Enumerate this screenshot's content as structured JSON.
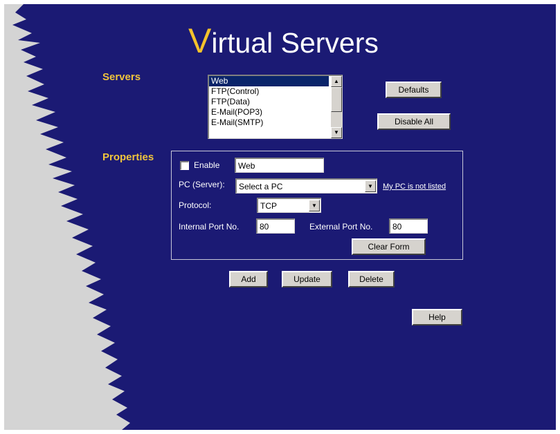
{
  "page": {
    "title_initial": "V",
    "title_rest": "irtual Servers",
    "colors": {
      "background": "#1b1a74",
      "side_panel": "#d4d4d4",
      "heading": "#f0c43c",
      "title_accent": "#f3c22c"
    }
  },
  "servers": {
    "heading": "Servers",
    "list_items": [
      "Web",
      "FTP(Control)",
      "FTP(Data)",
      "E-Mail(POP3)",
      "E-Mail(SMTP)"
    ],
    "selected": "Web",
    "defaults_label": "Defaults",
    "disable_all_label": "Disable All"
  },
  "properties": {
    "heading": "Properties",
    "enable_label": "Enable",
    "enable_checked": false,
    "name_value": "Web",
    "pc_label": "PC (Server):",
    "pc_value": "Select a PC",
    "pc_link": "My PC is not listed",
    "protocol_label": "Protocol:",
    "protocol_value": "TCP",
    "internal_port_label": "Internal Port No.",
    "internal_port_value": "80",
    "external_port_label": "External Port No.",
    "external_port_value": "80",
    "clear_form_label": "Clear Form"
  },
  "actions": {
    "add_label": "Add",
    "update_label": "Update",
    "delete_label": "Delete",
    "help_label": "Help"
  }
}
